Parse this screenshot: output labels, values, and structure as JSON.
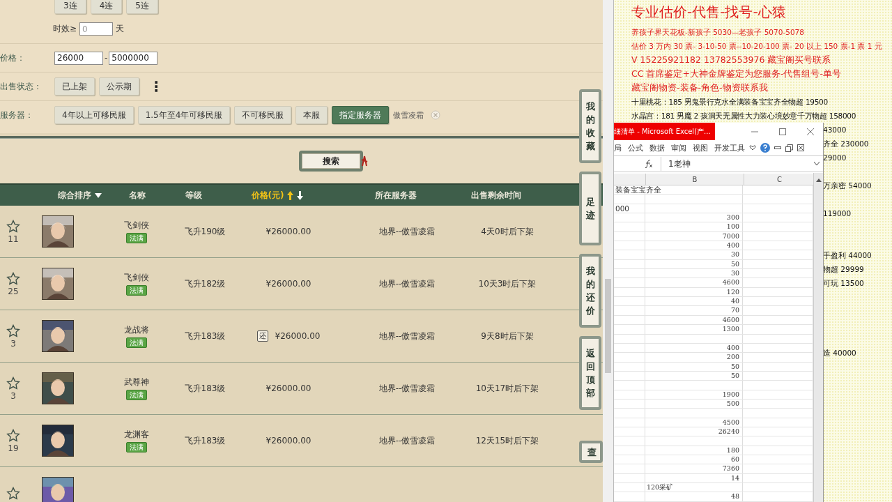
{
  "filters": {
    "streak_buttons": [
      "3连",
      "4连",
      "5连"
    ],
    "validity": {
      "label": "时效≥",
      "value": "0",
      "unit": "天"
    },
    "price": {
      "label": "价格：",
      "min": "26000",
      "separator": "-",
      "max": "5000000"
    },
    "sale_status": {
      "label": "出售状态：",
      "options": [
        "已上架",
        "公示期"
      ],
      "more": "⋮"
    },
    "server": {
      "label": "服务器：",
      "options": [
        {
          "label": "4年以上可移民服",
          "selected": false
        },
        {
          "label": "1.5年至4年可移民服",
          "selected": false
        },
        {
          "label": "不可移民服",
          "selected": false
        },
        {
          "label": "本服",
          "selected": false
        },
        {
          "label": "指定服务器",
          "selected": true
        }
      ],
      "chosen": "傲雪凌霜"
    }
  },
  "search_button": "搜索",
  "table": {
    "columns": [
      {
        "label": "综合排序",
        "kind": "dropdown",
        "selected": false
      },
      {
        "label": "名称",
        "kind": "plain",
        "selected": false
      },
      {
        "label": "等级",
        "kind": "plain",
        "selected": false
      },
      {
        "label": "价格(元)",
        "kind": "sort",
        "selected": true
      },
      {
        "label": "所在服务器",
        "kind": "plain",
        "selected": false
      },
      {
        "label": "出售剩余时间",
        "kind": "plain",
        "selected": false
      }
    ],
    "rows": [
      {
        "kind": "full",
        "favorites": "11",
        "name": "飞剑侠",
        "badge": "法满",
        "level": "飞升190级",
        "price": "¥26000.00",
        "server": "地界--傲雪凌霜",
        "time": "4天0时后下架"
      },
      {
        "kind": "full",
        "favorites": "25",
        "name": "飞剑侠",
        "badge": "法满",
        "level": "飞升182级",
        "price": "¥26000.00",
        "server": "地界--傲雪凌霜",
        "time": "10天3时后下架"
      },
      {
        "kind": "full",
        "favorites": "3",
        "name": "龙战将",
        "badge": "法满",
        "level": "飞升183级",
        "counter_offer": "还",
        "price": "¥26000.00",
        "server": "地界--傲雪凌霜",
        "time": "9天8时后下架"
      },
      {
        "kind": "full",
        "favorites": "3",
        "name": "武尊神",
        "badge": "法满",
        "level": "飞升183级",
        "price": "¥26000.00",
        "server": "地界--傲雪凌霜",
        "time": "10天17时后下架"
      },
      {
        "kind": "full",
        "favorites": "19",
        "name": "龙渊客",
        "badge": "法满",
        "level": "飞升183级",
        "price": "¥26000.00",
        "server": "地界--傲雪凌霜",
        "time": "12天15时后下架"
      },
      {
        "kind": "partial"
      }
    ]
  },
  "side_buttons": [
    "我的收藏",
    "足迹",
    "我的还价",
    "返回顶部",
    "查"
  ],
  "document": {
    "lines": [
      {
        "kind": "title",
        "text": "专业估价-代售-找号-心猿"
      },
      {
        "kind": "red",
        "text": "养孩子界天花板-新孩子 5030—老孩子 5070-5078"
      },
      {
        "kind": "red",
        "text": "估价 3 万内 30 票- 3-10-50 票--10-20-100 票- 20 以上 150 票-1 票 1 元"
      },
      {
        "kind": "red-large",
        "text": "V 15225921182      13782553976    藏宝阁买号联系"
      },
      {
        "kind": "red-large",
        "text": "CC 首席鉴定+大神金牌鉴定为您服务-代售组号-单号"
      },
      {
        "kind": "red-large",
        "text": "藏宝阁物资-装备-角色-物资联系我"
      },
      {
        "kind": "full",
        "text": "十里桃花：185 男鬼景行克水全满装备宝宝齐全物超 19500"
      },
      {
        "kind": "full",
        "text": "水晶宫：181 男魔 2 孩洞天无属性大力装心境妙意千万物超 158000"
      },
      {
        "kind": "tail",
        "text": "43000"
      },
      {
        "kind": "tail",
        "text": "齐全 230000"
      },
      {
        "kind": "tail",
        "text": "29000"
      },
      {
        "kind": "gap"
      },
      {
        "kind": "tail",
        "text": "万亲密 54000"
      },
      {
        "kind": "gap"
      },
      {
        "kind": "tail",
        "text": "119000"
      },
      {
        "kind": "gap"
      },
      {
        "kind": "gap"
      },
      {
        "kind": "tail",
        "text": "手盈利 44000"
      },
      {
        "kind": "tail",
        "text": "物超 29999"
      },
      {
        "kind": "tail",
        "text": "可玩 13500"
      },
      {
        "kind": "gap"
      },
      {
        "kind": "gap"
      },
      {
        "kind": "gap"
      },
      {
        "kind": "gap"
      },
      {
        "kind": "tail",
        "text": "造 40000"
      }
    ]
  },
  "excel": {
    "title": "细清单 - Microsoft Excel(产...",
    "ribbon_tabs": [
      "局",
      "公式",
      "数据",
      "审阅",
      "视图",
      "开发工具"
    ],
    "formula": "1老神",
    "column_headers": [
      "B",
      "C"
    ],
    "cells": [
      {
        "kind": "a",
        "text": "装备宝宝齐全"
      },
      {
        "kind": "empty"
      },
      {
        "kind": "a",
        "text": "000"
      },
      {
        "kind": "num",
        "text": "300"
      },
      {
        "kind": "num",
        "text": "100"
      },
      {
        "kind": "num",
        "text": "7000"
      },
      {
        "kind": "num",
        "text": "400"
      },
      {
        "kind": "num",
        "text": "30"
      },
      {
        "kind": "num",
        "text": "50"
      },
      {
        "kind": "num",
        "text": "30"
      },
      {
        "kind": "num",
        "text": "4600"
      },
      {
        "kind": "num",
        "text": "120"
      },
      {
        "kind": "num",
        "text": "40"
      },
      {
        "kind": "num",
        "text": "70"
      },
      {
        "kind": "num",
        "text": "4600"
      },
      {
        "kind": "num",
        "text": "1300"
      },
      {
        "kind": "empty"
      },
      {
        "kind": "num",
        "text": "400"
      },
      {
        "kind": "num",
        "text": "200"
      },
      {
        "kind": "num",
        "text": "50"
      },
      {
        "kind": "num",
        "text": "50"
      },
      {
        "kind": "empty"
      },
      {
        "kind": "num",
        "text": "1900"
      },
      {
        "kind": "num",
        "text": "500"
      },
      {
        "kind": "empty"
      },
      {
        "kind": "num",
        "text": "4500"
      },
      {
        "kind": "num",
        "text": "26240"
      },
      {
        "kind": "empty"
      },
      {
        "kind": "num",
        "text": "180"
      },
      {
        "kind": "num",
        "text": "60"
      },
      {
        "kind": "num",
        "text": "7360"
      },
      {
        "kind": "num",
        "text": "14"
      },
      {
        "kind": "btext",
        "text": "120采矿"
      },
      {
        "kind": "num",
        "text": "48"
      }
    ]
  }
}
